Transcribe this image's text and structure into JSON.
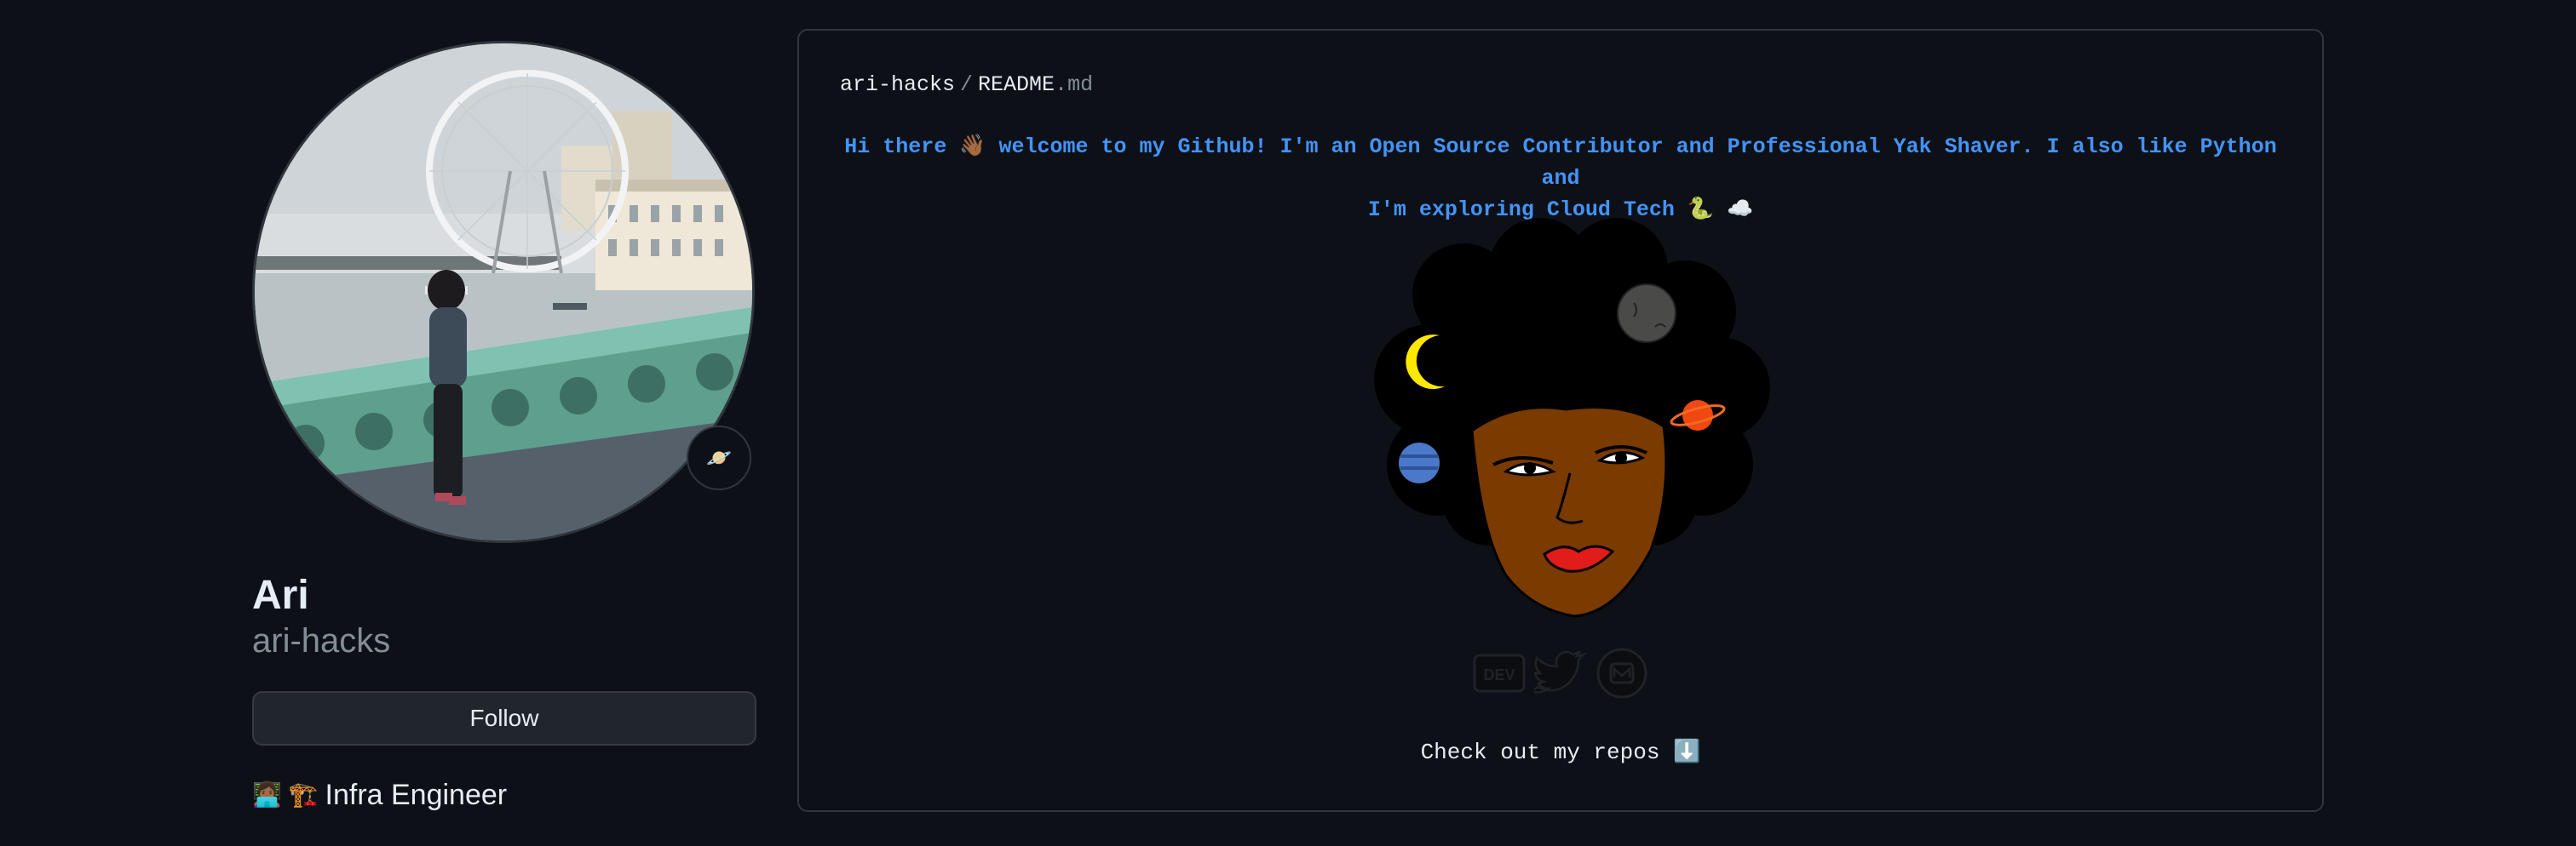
{
  "profile": {
    "display_name": "Ari",
    "login": "ari-hacks",
    "follow_label": "Follow",
    "status_icon": "planet-emoji",
    "bio_emojis": "👩🏾‍💻 🏗️",
    "bio_text": "Infra Engineer"
  },
  "readme": {
    "path_user": "ari-hacks",
    "path_sep": "/",
    "path_file": "README",
    "path_ext": ".md",
    "intro_line1": "Hi there 👋🏾 welcome to my Github! I'm an Open Source Contributor and Professional Yak Shaver. I also like Python and",
    "intro_line2": "I'm exploring Cloud Tech 🐍 ☁️",
    "social_icons": [
      "dev-icon",
      "twitter-icon",
      "medium-icon"
    ],
    "repos_text": "Check out my repos ⬇️"
  },
  "colors": {
    "background": "#0d1117",
    "link_blue": "#4493f8",
    "border": "#30363d",
    "muted": "#848d97"
  }
}
